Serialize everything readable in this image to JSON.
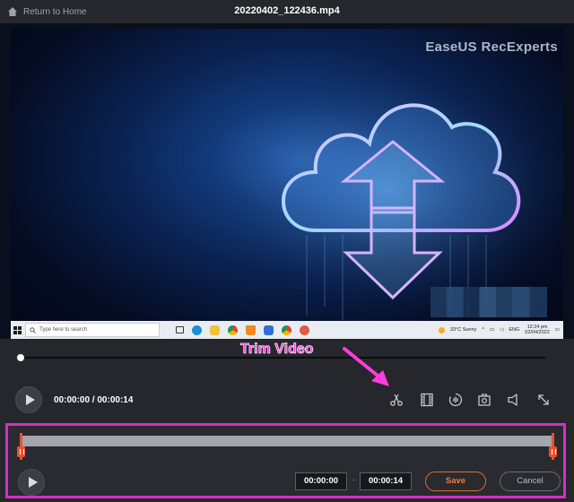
{
  "header": {
    "back_label": "Return to Home",
    "file_name": "20220402_122436.mp4"
  },
  "video": {
    "watermark": "EaseUS RecExperts",
    "taskbar": {
      "search_placeholder": "Type here to search",
      "weather": "33°C  Sunny",
      "language": "ENG",
      "time": "12:24 pm",
      "date": "02/04/2022"
    }
  },
  "playback": {
    "progress": 0.0,
    "current_time": "00:00:00",
    "separator": " / ",
    "total_time": "00:00:14"
  },
  "annotation": {
    "label": "Trim Video",
    "color": "#ff3ddb"
  },
  "toolbar": {
    "icons": [
      "trim-icon",
      "filmstrip-icon",
      "audio-icon",
      "screenshot-icon",
      "volume-icon",
      "fullscreen-icon"
    ]
  },
  "trim": {
    "start_time": "00:00:00",
    "end_time": "00:00:14",
    "dash": "-",
    "save_label": "Save",
    "cancel_label": "Cancel",
    "border_color": "#d62fc5",
    "accent_color": "#e9522e"
  }
}
